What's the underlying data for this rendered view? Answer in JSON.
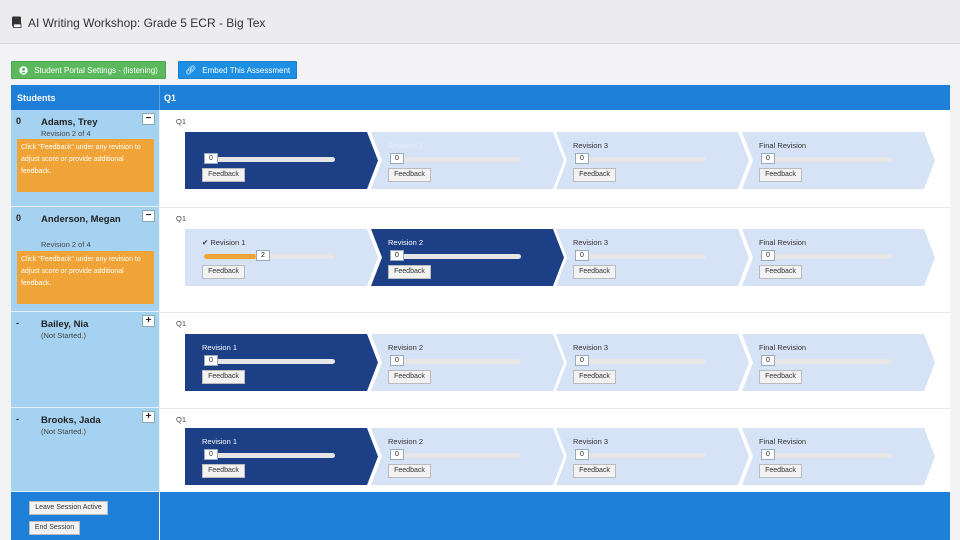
{
  "header": {
    "title": "AI Writing Workshop: Grade 5 ECR - Big Tex",
    "icon": "book-icon"
  },
  "toolbar": {
    "portal_label": "Student Portal Settings - (listening)",
    "portal_icon": "user-circle-icon",
    "embed_label": "Embed This Assessment",
    "embed_icon": "link-icon"
  },
  "table": {
    "students_header": "Students",
    "question_header": "Q1"
  },
  "colors": {
    "accent": "#1e7fd9",
    "active_stage": "#1c3f86",
    "inactive_stage": "#d6e2f5",
    "note": "#f0a337",
    "side": "#a4d2f0"
  },
  "students": [
    {
      "score": "0",
      "name": "Adams, Trey",
      "status": "Revision 2 of 4",
      "toggle": "−",
      "note": "Click \"Feedback\" under any revision to adjust score or provide additional feedback.",
      "question": "Q1",
      "stages": [
        {
          "label": "",
          "value": "0",
          "level": 0,
          "feedback": "Feedback"
        },
        {
          "label": "Revision 2",
          "value": "0",
          "level": 0,
          "feedback": "Feedback"
        },
        {
          "label": "Revision 3",
          "value": "0",
          "level": 0,
          "feedback": "Feedback"
        },
        {
          "label": "Final Revision",
          "value": "0",
          "level": 0,
          "feedback": "Feedback"
        }
      ]
    },
    {
      "score": "0",
      "name": "Anderson, Megan",
      "status": "Revision 2 of 4",
      "toggle": "−",
      "note": "Click \"Feedback\" under any revision to adjust score or provide additional feedback.",
      "question": "Q1",
      "stages": [
        {
          "label": "✔ Revision 1",
          "value": "2",
          "level": 0.4,
          "feedback": "Feedback"
        },
        {
          "label": "Revision 2",
          "value": "0",
          "level": 0,
          "feedback": "Feedback"
        },
        {
          "label": "Revision 3",
          "value": "0",
          "level": 0,
          "feedback": "Feedback"
        },
        {
          "label": "Final Revision",
          "value": "0",
          "level": 0,
          "feedback": "Feedback"
        }
      ]
    },
    {
      "score": "-",
      "name": "Bailey, Nia",
      "status": "(Not Started.)",
      "toggle": "+",
      "question": "Q1",
      "stages": [
        {
          "label": "Revision 1",
          "value": "0",
          "level": 0,
          "feedback": "Feedback"
        },
        {
          "label": "Revision 2",
          "value": "0",
          "level": 0,
          "feedback": "Feedback"
        },
        {
          "label": "Revision 3",
          "value": "0",
          "level": 0,
          "feedback": "Feedback"
        },
        {
          "label": "Final Revision",
          "value": "0",
          "level": 0,
          "feedback": "Feedback"
        }
      ]
    },
    {
      "score": "-",
      "name": "Brooks, Jada",
      "status": "(Not Started.)",
      "toggle": "+",
      "question": "Q1",
      "stages": [
        {
          "label": "Revision 1",
          "value": "0",
          "level": 0,
          "feedback": "Feedback"
        },
        {
          "label": "Revision 2",
          "value": "0",
          "level": 0,
          "feedback": "Feedback"
        },
        {
          "label": "Revision 3",
          "value": "0",
          "level": 0,
          "feedback": "Feedback"
        },
        {
          "label": "Final Revision",
          "value": "0",
          "level": 0,
          "feedback": "Feedback"
        }
      ]
    }
  ],
  "footer": {
    "leave_label": "Leave Session Active",
    "end_label": "End Session"
  }
}
